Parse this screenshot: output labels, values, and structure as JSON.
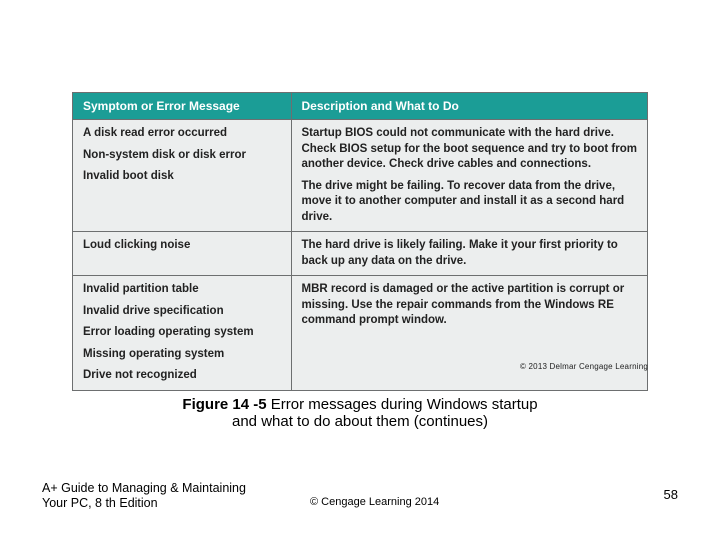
{
  "table": {
    "headers": {
      "col1": "Symptom or Error Message",
      "col2": "Description and What to Do"
    },
    "rows": [
      {
        "symptoms": [
          "A disk read error occurred",
          "Non-system disk or disk error",
          "Invalid boot disk"
        ],
        "description": [
          "Startup BIOS could not communicate with the hard drive. Check BIOS setup for the boot sequence and try to boot from another device. Check drive cables and connections.",
          "The drive might be failing. To recover data from the drive, move it to another computer and install it as a second hard drive."
        ]
      },
      {
        "symptoms": [
          "Loud clicking noise"
        ],
        "description": [
          "The hard drive is likely failing. Make it your first priority to back up any data on the drive."
        ]
      },
      {
        "symptoms": [
          "Invalid partition table",
          "Invalid drive specification",
          "Error loading operating system",
          "Missing operating system",
          "Drive not recognized"
        ],
        "description": [
          "MBR record is damaged or the active partition is corrupt or missing. Use the repair commands from the Windows RE command prompt window."
        ]
      }
    ]
  },
  "credit": "© 2013 Delmar Cengage Learning",
  "caption": {
    "fignum": "Figure 14 -5",
    "rest1": "  Error messages during Windows startup",
    "line2": "and what to do about them (continues)"
  },
  "footer": {
    "book": "A+ Guide to Managing & Maintaining Your PC, 8 th Edition",
    "copyright": "© Cengage Learning  2014",
    "pagenum": "58"
  }
}
